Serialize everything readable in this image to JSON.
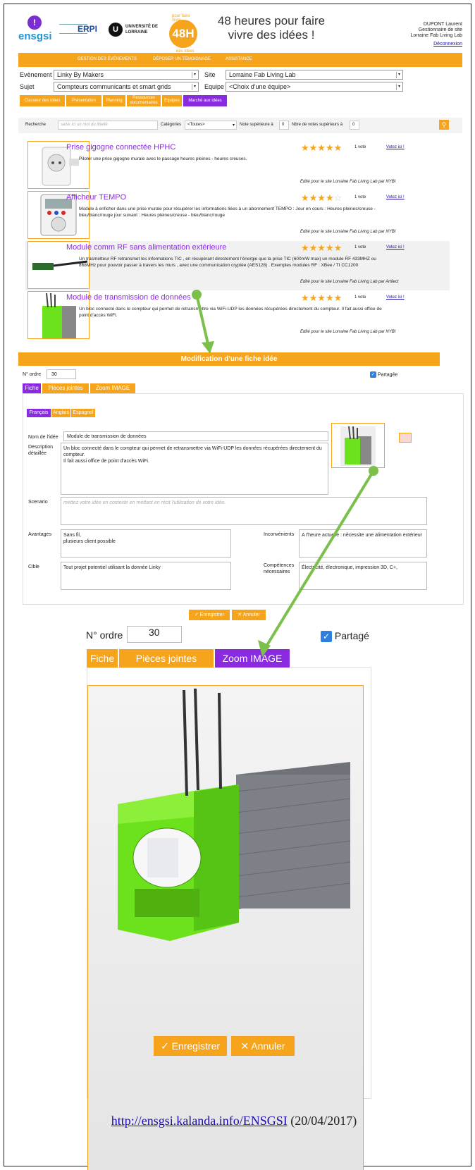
{
  "header": {
    "logo_ensgsi": "ensgsi",
    "logo_erpi": "ERPI",
    "logo_ul_text": "UNIVERSITÉ DE LORRAINE",
    "logo_48": "48H",
    "logo_48_top": "pour faire vivre",
    "logo_48_bottom": "des idées",
    "title": "48 heures pour faire vivre des idées !",
    "user_name": "DUPONT Laurent",
    "user_role": "Gestionnaire de site",
    "user_site": "Lorraine Fab Living Lab",
    "logout": "Déconnexion"
  },
  "nav": {
    "items": [
      "GESTION DES ÉVÉNEMENTS",
      "DÉPOSER UN TÉMOIGNAGE",
      "ASSISTANCE"
    ]
  },
  "selectors": {
    "evenement_label": "Evènement",
    "evenement_value": "Linky By Makers",
    "site_label": "Site",
    "site_value": "Lorraine Fab Living Lab",
    "sujet_label": "Sujet",
    "sujet_value": "Compteurs communicants et smart grids",
    "equipe_label": "Equipe",
    "equipe_value": "<Choix d'une équipe>"
  },
  "tabs": [
    "Classeur des idées",
    "Présentation",
    "Planning",
    "Ressources documentaires",
    "Equipes",
    "Marché aux idées"
  ],
  "search": {
    "label": "Recherche",
    "placeholder": "saisir ici un mot du libellé",
    "categories_label": "Catégories",
    "categories_value": "<Toutes>",
    "note_label": "Note supérieure à",
    "note_value": "0",
    "nb_votes_label": "Nbre de votes supérieurs à",
    "nb_votes_value": "0"
  },
  "ideas": [
    {
      "title": "Prise gigogne connectée HPHC",
      "description": "Piloter une prise gigogne murale avec le passage heures pleines - heures creuses.",
      "rating": 5,
      "votes": "1 vote",
      "vote_link": "Votez ici !",
      "edited": "Edité pour le site Lorraine Fab Living Lab par NYBI"
    },
    {
      "title": "Afficheur TEMPO",
      "description": "Module à enficher dans une prise murale pour récupérer les informations liées à un abonnement TEMPO : Jour en cours : Heures pleines/creuse - bleu/blanc/rouge jour suivant : Heures pleines/creuse - bleu/blanc/rouge",
      "rating": 4,
      "votes": "1 vote",
      "vote_link": "Votez ici !",
      "edited": "Edité pour le site Lorraine Fab Living Lab par NYBI"
    },
    {
      "title": "Module comm RF sans alimentation extérieure",
      "description": "Un trasmetteur RF retransmet les informations TIC , en récupérant directement l'énergie que la prise TIC (600mW max) un module RF 433MHZ ou 868MHz pour pouvoir passer à travers les murs , avec une communication cryptée (AES128) . Exemples modules RF : XBee / TI CC1200",
      "rating": 5,
      "votes": "1 vote",
      "vote_link": "Votez ici !",
      "edited": "Edité pour le site Lorraine Fab Living Lab par Artilect"
    },
    {
      "title": "Module de transmission de données",
      "description": "Un bloc connecté dans le compteur qui permet de retransmettre via WiFi-UDP les données récupérées directement du compteur. Il fait aussi office de point d'accès WiFi.",
      "rating": 5,
      "votes": "1 vote",
      "vote_link": "Votez ici !",
      "edited": "Edité pour le site Lorraine Fab Living Lab par NYBI"
    }
  ],
  "form": {
    "title": "Modification d'une fiche idée",
    "order_label": "N° ordre",
    "order_value": "30",
    "shared_label": "Partagée",
    "tabs": [
      "Fiche",
      "Pièces jointes",
      "Zoom IMAGE"
    ],
    "lang_tabs": [
      "Français",
      "Anglais",
      "Espagnol"
    ],
    "name_label": "Nom de l'idée",
    "name_value": "Module de transmission de données",
    "desc_label": "Description détaillée",
    "desc_value_1": "Un bloc connecté dans le compteur qui permet de retransmettre via WiFi-UDP les données récupérées directement du compteur.",
    "desc_value_2": "Il fait aussi office de point d'accès WiFi.",
    "scenario_label": "Scenario",
    "scenario_placeholder": "mettez votre idée en contexte en mettant en récit l'utilisation de votre idée.",
    "avantages_label": "Avantages",
    "avantages_value_1": "Sans fil,",
    "avantages_value_2": "plusieurs client possible",
    "inconvenients_label": "Inconvénients",
    "inconvenients_value": "A l'heure actuelle : nécessite une alimentation extérieur",
    "cible_label": "Cible",
    "cible_value": "Tout projet potentiel utilisant la donnée Linky",
    "competences_label": "Compétences nécessaires",
    "competences_value": "Électricité, électronique, impression 3D, C+,",
    "save": "Enregistrer",
    "cancel": "Annuler"
  },
  "zoom": {
    "order_label": "N° ordre",
    "order_value": "30",
    "shared_label": "Partagé",
    "tabs": [
      "Fiche",
      "Pièces jointes",
      "Zoom IMAGE"
    ],
    "save": "Enregistrer",
    "cancel": "Annuler"
  },
  "footer": {
    "link": "http://ensgsi.kalanda.info/ENSGSI",
    "date": "(20/04/2017)"
  },
  "colors": {
    "orange": "#f5a41b",
    "purple": "#8a2be2",
    "arrow": "#7cbf4a"
  }
}
